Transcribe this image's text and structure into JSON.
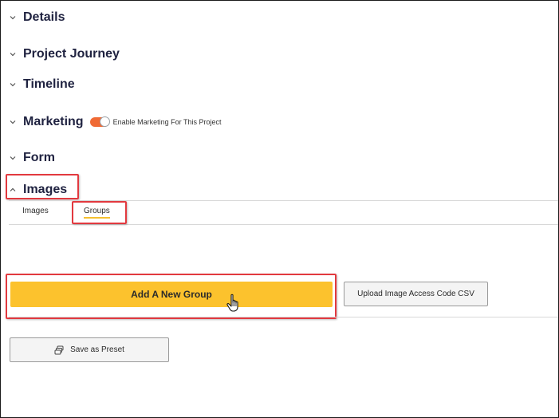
{
  "sections": [
    {
      "title": "Details",
      "expanded": false
    },
    {
      "title": "Project Journey",
      "expanded": false
    },
    {
      "title": "Timeline",
      "expanded": false
    },
    {
      "title": "Marketing",
      "expanded": false
    },
    {
      "title": "Form",
      "expanded": false
    },
    {
      "title": "Images",
      "expanded": true
    }
  ],
  "marketing": {
    "toggle_label": "Enable Marketing For This Project",
    "toggle_on": true,
    "toggle_color": "#f06a35"
  },
  "images": {
    "tabs": [
      {
        "label": "Images",
        "active": false
      },
      {
        "label": "Groups",
        "active": true
      }
    ],
    "add_group_label": "Add A New Group",
    "upload_csv_label": "Upload Image Access Code CSV"
  },
  "preset": {
    "save_label": "Save as Preset",
    "icon": "stack-icon"
  },
  "colors": {
    "primary_button": "#fcc22d",
    "highlight_box": "#e2393f",
    "tab_underline": "#f5c030"
  }
}
